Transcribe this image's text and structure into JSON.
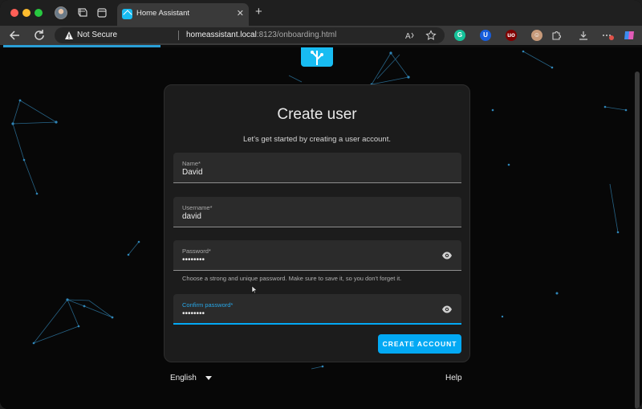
{
  "browser": {
    "tab_title": "Home Assistant",
    "new_tab_glyph": "+",
    "close_glyph": "✕",
    "security_label": "Not Secure",
    "url_host": "homeassistant.local",
    "url_rest": ":8123/onboarding.html",
    "load_progress": 0.245,
    "extensions": [
      {
        "name": "grammarly-extension-icon",
        "glyph": "G",
        "color": "#15c39a"
      },
      {
        "name": "bitwarden-extension-icon",
        "glyph": "U",
        "color": "#175ddc"
      },
      {
        "name": "ublock-extension-icon",
        "glyph": "uo",
        "color": "#800000"
      },
      {
        "name": "avatar-extension-icon",
        "glyph": "☺",
        "color": "#c79a7a"
      }
    ]
  },
  "form": {
    "title": "Create user",
    "subtitle": "Let's get started by creating a user account.",
    "name": {
      "label": "Name*",
      "value": "David"
    },
    "username": {
      "label": "Username*",
      "value": "david"
    },
    "password": {
      "label": "Password*",
      "value": "••••••••"
    },
    "password_helper": "Choose a strong and unique password. Make sure to save it, so you don't forget it.",
    "confirm_password": {
      "label": "Confirm password*",
      "value": "••••••••"
    },
    "submit_label": "CREATE ACCOUNT"
  },
  "footer": {
    "language": "English",
    "help_label": "Help"
  },
  "colors": {
    "accent": "#03a9f4",
    "brand": "#18bcf2"
  }
}
